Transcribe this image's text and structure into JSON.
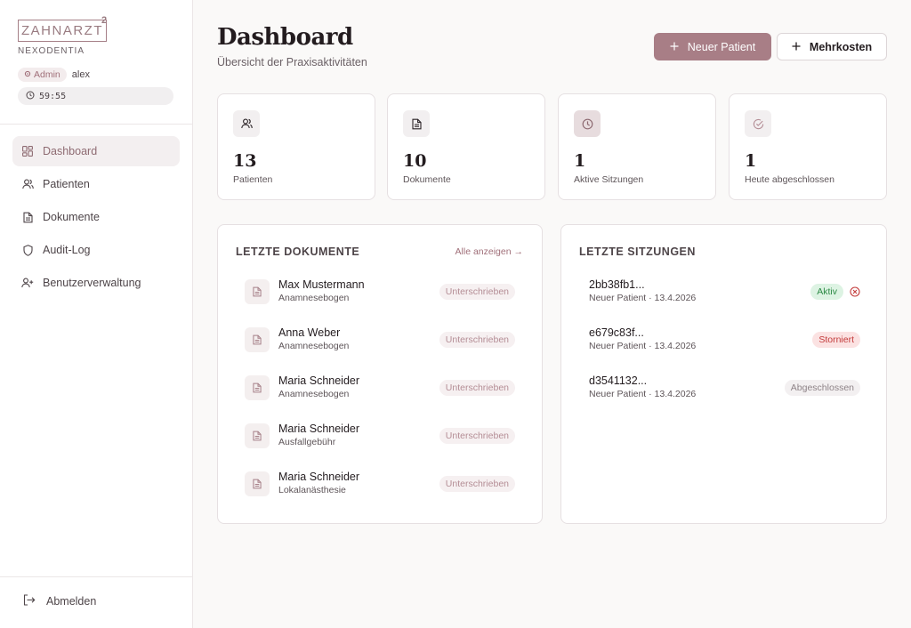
{
  "sidebar": {
    "brand": "ZAHNARZT",
    "brand_sup": "2",
    "brand_sub": "NEXODENTIA",
    "role": "Admin",
    "username": "alex",
    "timer": "59:55",
    "nav": [
      {
        "label": "Dashboard",
        "icon": "grid-icon",
        "active": true
      },
      {
        "label": "Patienten",
        "icon": "users-icon",
        "active": false
      },
      {
        "label": "Dokumente",
        "icon": "file-icon",
        "active": false
      },
      {
        "label": "Audit-Log",
        "icon": "shield-icon",
        "active": false
      },
      {
        "label": "Benutzerverwaltung",
        "icon": "user-plus-icon",
        "active": false
      }
    ],
    "logout": "Abmelden"
  },
  "header": {
    "title": "Dashboard",
    "subtitle": "Übersicht der Praxisaktivitäten",
    "new_patient": "Neuer Patient",
    "extra_costs": "Mehrkosten"
  },
  "stats": [
    {
      "value": "13",
      "label": "Patienten",
      "icon": "users-icon"
    },
    {
      "value": "10",
      "label": "Dokumente",
      "icon": "file-icon"
    },
    {
      "value": "1",
      "label": "Aktive Sitzungen",
      "icon": "clock-icon"
    },
    {
      "value": "1",
      "label": "Heute abgeschlossen",
      "icon": "check-circle-icon"
    }
  ],
  "documents": {
    "title": "LETZTE DOKUMENTE",
    "link": "Alle anzeigen",
    "items": [
      {
        "name": "Max Mustermann",
        "type": "Anamnesebogen",
        "status": "Unterschrieben"
      },
      {
        "name": "Anna Weber",
        "type": "Anamnesebogen",
        "status": "Unterschrieben"
      },
      {
        "name": "Maria Schneider",
        "type": "Anamnesebogen",
        "status": "Unterschrieben"
      },
      {
        "name": "Maria Schneider",
        "type": "Ausfallgebühr",
        "status": "Unterschrieben"
      },
      {
        "name": "Maria Schneider",
        "type": "Lokalanästhesie",
        "status": "Unterschrieben"
      }
    ]
  },
  "sessions": {
    "title": "LETZTE SITZUNGEN",
    "items": [
      {
        "id": "2bb38fb1...",
        "meta": "Neuer Patient · 13.4.2026",
        "status": "Aktiv"
      },
      {
        "id": "e679c83f...",
        "meta": "Neuer Patient · 13.4.2026",
        "status": "Storniert"
      },
      {
        "id": "d3541132...",
        "meta": "Neuer Patient · 13.4.2026",
        "status": "Abgeschlossen"
      }
    ]
  },
  "colors": {
    "accent": "#a87e86",
    "active_green": "#2d8a46",
    "cancelled_red": "#c33b3b"
  }
}
